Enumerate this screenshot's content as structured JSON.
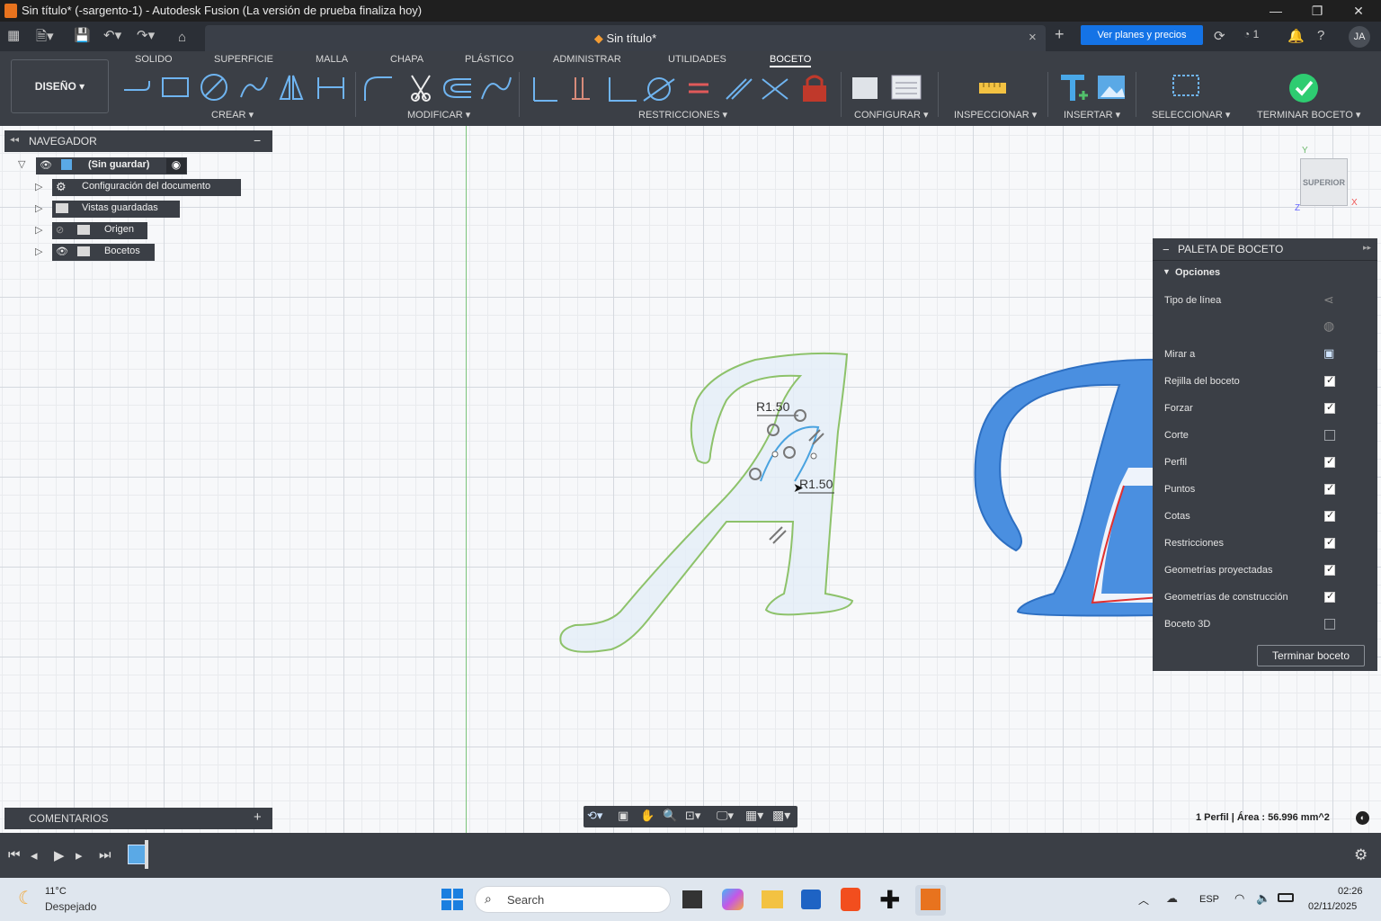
{
  "window": {
    "title": "Sin título* (-sargento-1) - Autodesk Fusion (La versión de prueba finaliza hoy)",
    "controls": {
      "minimize": "—",
      "maximize": "❐",
      "close": "✕"
    }
  },
  "tabs": {
    "doc_title": "Sin título*",
    "close": "×",
    "new_tab": "+",
    "plans_button": "Ver planes y precios",
    "jobs_count": "1",
    "avatar": "JA"
  },
  "workspace": {
    "label": "DISEÑO",
    "caret": "▾"
  },
  "toolbar_tabs": [
    "SOLIDO",
    "SUPERFICIE",
    "MALLA",
    "CHAPA",
    "PLÁSTICO",
    "ADMINISTRAR",
    "UTILIDADES",
    "BOCETO"
  ],
  "toolbar_groups": {
    "create": "CREAR",
    "modify": "MODIFICAR",
    "constraints": "RESTRICCIONES",
    "configure": "CONFIGURAR",
    "inspect": "INSPECCIONAR",
    "insert": "INSERTAR",
    "select": "SELECCIONAR",
    "finish": "TERMINAR BOCETO"
  },
  "navigator": {
    "title": "NAVEGADOR",
    "collapse": "−",
    "root": "(Sin guardar)",
    "items": [
      {
        "label": "Configuración del documento"
      },
      {
        "label": "Vistas guardadas"
      },
      {
        "label": "Origen"
      },
      {
        "label": "Bocetos"
      }
    ]
  },
  "viewcube": {
    "face": "SUPERIOR",
    "axis_y": "Y",
    "axis_x": "X",
    "axis_z": "Z"
  },
  "dimensions": {
    "dim1": "R1.50",
    "dim2": "R1.50"
  },
  "palette": {
    "title": "PALETA DE BOCETO",
    "section": "Opciones",
    "line_type_label": "Tipo de línea",
    "look_at_label": "Mirar a",
    "options": [
      {
        "label": "Rejilla del boceto",
        "checked": true
      },
      {
        "label": "Forzar",
        "checked": true
      },
      {
        "label": "Corte",
        "checked": false
      },
      {
        "label": "Perfil",
        "checked": true
      },
      {
        "label": "Puntos",
        "checked": true
      },
      {
        "label": "Cotas",
        "checked": true
      },
      {
        "label": "Restricciones",
        "checked": true
      },
      {
        "label": "Geometrías proyectadas",
        "checked": true
      },
      {
        "label": "Geometrías de construcción",
        "checked": true
      },
      {
        "label": "Boceto 3D",
        "checked": false
      }
    ],
    "finish_button": "Terminar boceto"
  },
  "comments": {
    "title": "COMENTARIOS",
    "add": "+"
  },
  "status": {
    "text": "1 Perfil | Área : 56.996 mm^2"
  },
  "taskbar": {
    "weather_temp": "11°C",
    "weather_desc": "Despejado",
    "search_placeholder": "Search",
    "language": "ESP",
    "time": "02:26",
    "date": "02/11/2025"
  },
  "colors": {
    "accent_blue": "#1473e6",
    "sketch_green": "#8dc26a",
    "profile_blue": "#4a8fe0",
    "finish_green": "#2ecc71",
    "dark_ui": "#3b3f46"
  }
}
